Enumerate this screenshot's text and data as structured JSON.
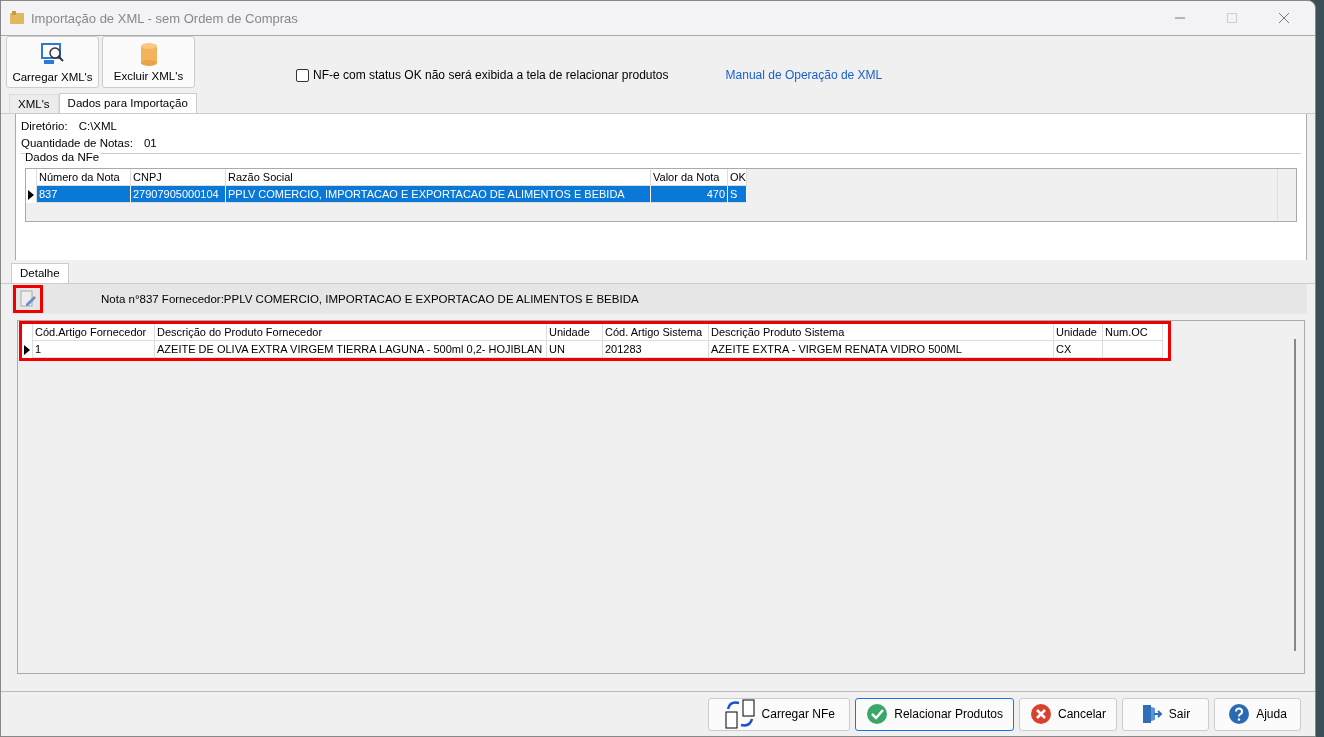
{
  "window": {
    "title": "Importação de XML - sem Ordem de Compras"
  },
  "toolbar": [
    {
      "label": "Carregar XML's",
      "kind": "load"
    },
    {
      "label": "Excluir XML's",
      "kind": "delete"
    }
  ],
  "option": {
    "label": "NF-e com status OK não será exibida a tela de relacionar produtos",
    "checked": false
  },
  "manual_link": "Manual de Operação de XML",
  "tabs": [
    {
      "label": "XML's",
      "selected": false
    },
    {
      "label": "Dados para Importação",
      "selected": true
    }
  ],
  "info": [
    {
      "label": "Diretório:",
      "value": "C:\\XML"
    },
    {
      "label": "Quantidade de Notas:",
      "value": "01"
    }
  ],
  "nfe_group": {
    "title": "Dados da NFe",
    "columns": [
      "Número da Nota",
      "CNPJ",
      "Razão Social",
      "Valor da Nota",
      "OK"
    ],
    "rows": [
      {
        "cells": [
          "837",
          "27907905000104",
          "PPLV COMERCIO, IMPORTACAO E EXPORTACAO DE ALIMENTOS E BEBIDA",
          "470",
          "S"
        ],
        "selected": true
      }
    ]
  },
  "detail_tabs": [
    {
      "label": "Detalhe",
      "selected": true
    }
  ],
  "detail_caption": "Nota n°837 Fornecedor:PPLV COMERCIO, IMPORTACAO E EXPORTACAO DE ALIMENTOS E BEBIDA",
  "items_table": {
    "columns": [
      "Cód.Artigo Fornecedor",
      "Descrição do Produto Fornecedor",
      "Unidade",
      "Cód. Artigo Sistema",
      "Descrição Produto Sistema",
      "Unidade",
      "Num.OC"
    ],
    "rows": [
      {
        "cells": [
          "1",
          "AZEITE DE OLIVA EXTRA VIRGEM TIERRA LAGUNA - 500ml 0,2- HOJIBLAN",
          "UN",
          "201283",
          "AZEITE EXTRA - VIRGEM RENATA VIDRO 500ML",
          "CX",
          ""
        ],
        "selected": false
      }
    ]
  },
  "buttons": [
    {
      "label": "Carregar NFe",
      "kind": "swap",
      "focused": false
    },
    {
      "label": "Relacionar Produtos",
      "kind": "ok",
      "focused": true
    },
    {
      "label": "Cancelar",
      "kind": "cancel",
      "focused": false
    },
    {
      "label": "Sair",
      "kind": "exit",
      "focused": false
    },
    {
      "label": "Ajuda",
      "kind": "help",
      "focused": false
    }
  ]
}
